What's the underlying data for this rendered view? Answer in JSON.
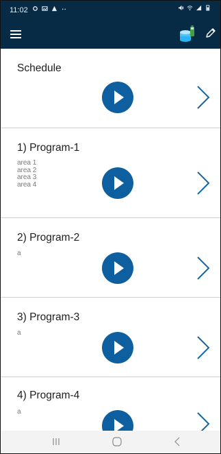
{
  "status_bar": {
    "time": "11:02"
  },
  "header": {
    "menu_icon": "menu-icon",
    "database_icon": "database-status-icon",
    "edit_icon": "edit-icon"
  },
  "schedules": [
    {
      "title": "Schedule",
      "areas": []
    },
    {
      "title": "1) Program-1",
      "areas": [
        "area 1",
        "area 2",
        "area 3",
        "area 4"
      ]
    },
    {
      "title": "2) Program-2",
      "areas": [
        "a"
      ]
    },
    {
      "title": "3) Program-3",
      "areas": [
        "a"
      ]
    },
    {
      "title": "4) Program-4",
      "areas": [
        "a"
      ]
    }
  ],
  "colors": {
    "header_bg": "#082b45",
    "play_button": "#0d5fa0",
    "chevron": "#1565a7"
  }
}
